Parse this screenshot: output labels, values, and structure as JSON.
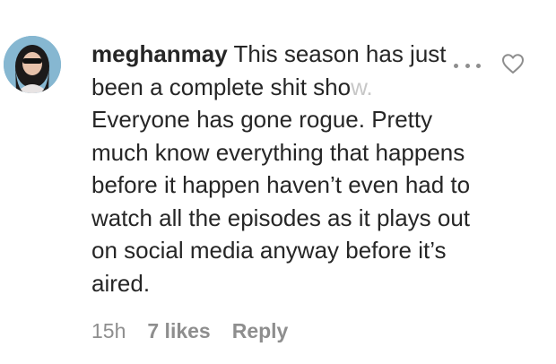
{
  "comment": {
    "username": "meghanmay",
    "text_before_fade": "This season has just been a complete shit sho",
    "text_faded": "w.",
    "text_after": "Everyone has gone rogue. Pretty much know everything that happens before it happen haven’t even had to watch all the episodes as it plays out on social media anyway before it’s aired.",
    "time": "15h",
    "likes": "7 likes",
    "reply_label": "Reply"
  },
  "icons": {
    "avatar": "profile-photo",
    "more": "more-options-icon",
    "like": "heart-icon"
  }
}
